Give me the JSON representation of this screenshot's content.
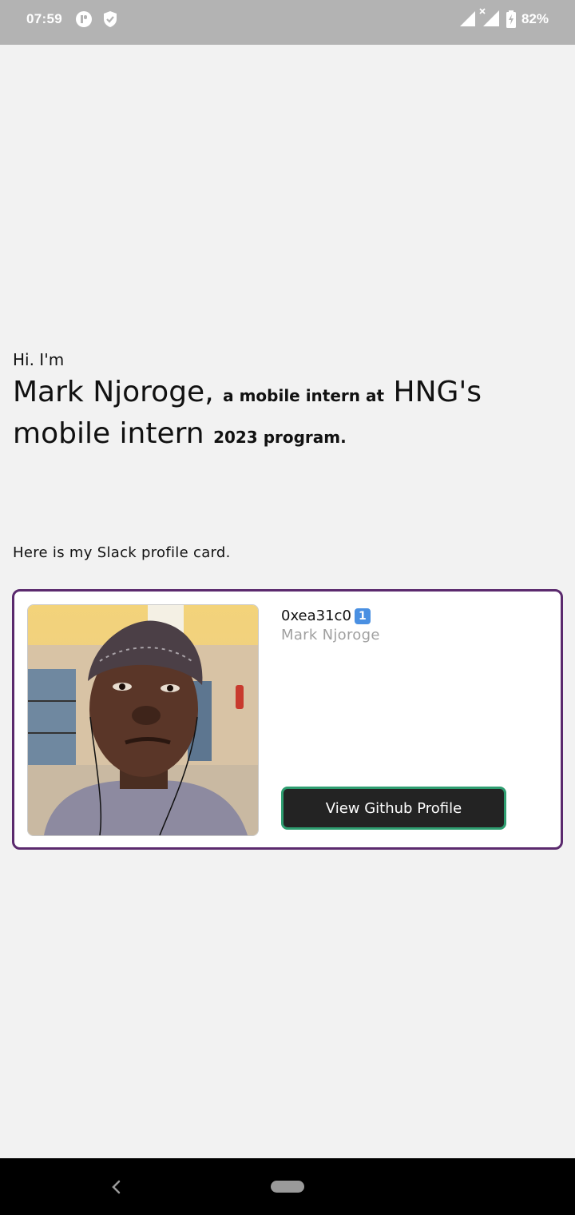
{
  "status_bar": {
    "time": "07:59",
    "battery": "82%",
    "icons": [
      "app-notification-icon",
      "shield-check-icon",
      "signal-icon",
      "signal-no-data-icon",
      "battery-charging-icon"
    ]
  },
  "greeting": "Hi. I'm",
  "headline": {
    "name": "Mark Njoroge,",
    "role_small": "a mobile intern at",
    "org": "HNG's mobile intern",
    "program_small": "2023 program."
  },
  "intro": "Here is my Slack profile card.",
  "profile_card": {
    "handle": "0xea31c0",
    "badge": "1",
    "name": "Mark Njoroge",
    "button_label": "View Github Profile",
    "border_color": "#5b2a6e",
    "button_border_color": "#2e9d70"
  },
  "nav_bar": {
    "icons": [
      "back-icon",
      "home-pill-icon"
    ]
  }
}
